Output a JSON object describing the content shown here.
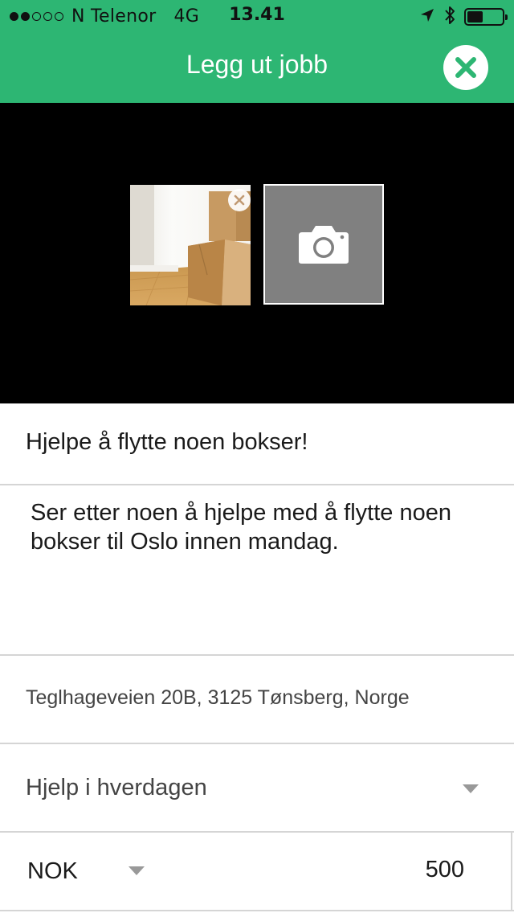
{
  "status_bar": {
    "signal_strength": 2,
    "signal_total": 5,
    "carrier": "N Telenor",
    "network": "4G",
    "time": "13.41",
    "icons": [
      "location-arrow-icon",
      "bluetooth-icon",
      "battery-icon"
    ],
    "battery_level": 0.45
  },
  "header": {
    "title": "Legg ut jobb",
    "close_icon": "close-icon",
    "accent_color": "#2db673"
  },
  "photos": {
    "thumbnail_remove_icon": "close-icon",
    "add_photo_icon": "camera-icon"
  },
  "form": {
    "title_value": "Hjelpe å flytte noen bokser!",
    "description_value": "Ser etter noen å hjelpe med å flytte noen bokser til Oslo innen mandag.",
    "address_value": "Teglhageveien 20B, 3125 Tønsberg, Norge",
    "category_value": "Hjelp i hverdagen",
    "currency_value": "NOK",
    "price_value": "500"
  }
}
